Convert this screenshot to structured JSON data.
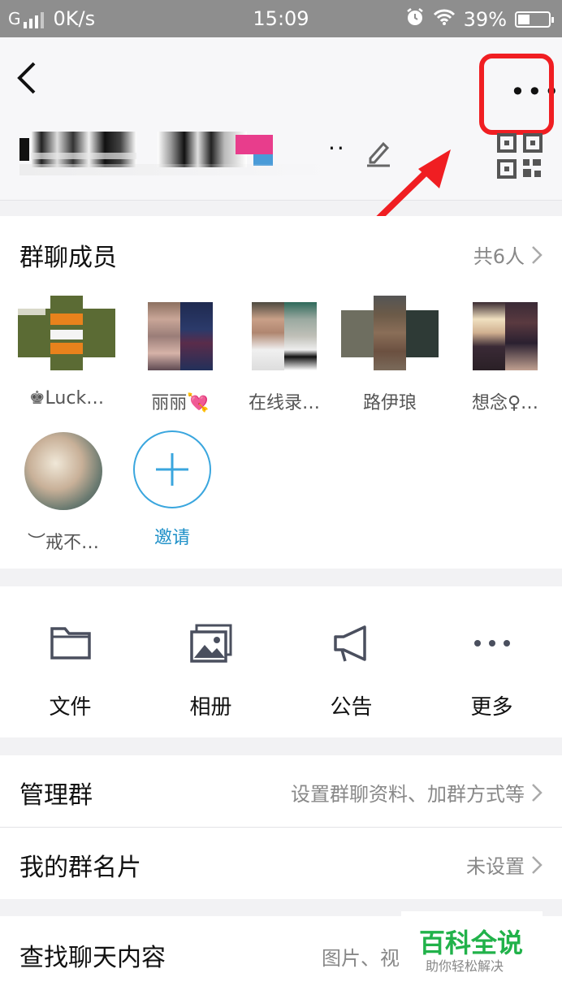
{
  "status_bar": {
    "signal": "G",
    "speed": "0K/s",
    "time": "15:09",
    "battery": "39%"
  },
  "group_title_ellipsis": "··",
  "members_section": {
    "title": "群聊成员",
    "count": "共6人",
    "members": [
      {
        "name": "♚Luck…"
      },
      {
        "name": "丽丽💘"
      },
      {
        "name": "在线录…"
      },
      {
        "name": "路伊琅"
      },
      {
        "name": "想念♀…"
      },
      {
        "name": "︶戒不…"
      }
    ],
    "invite_label": "邀请"
  },
  "tools": [
    {
      "label": "文件",
      "icon": "folder-icon"
    },
    {
      "label": "相册",
      "icon": "album-icon"
    },
    {
      "label": "公告",
      "icon": "megaphone-icon"
    },
    {
      "label": "更多",
      "icon": "more-icon"
    }
  ],
  "rows": {
    "manage": {
      "label": "管理群",
      "value": "设置群聊资料、加群方式等"
    },
    "card": {
      "label": "我的群名片",
      "value": "未设置"
    },
    "search": {
      "label": "查找聊天内容",
      "value": "图片、视"
    }
  },
  "watermark": {
    "title": "百科全说",
    "subtitle": "助你轻松解决"
  },
  "colors": {
    "accent": "#1e90c8",
    "highlight": "#f01e22",
    "watermark": "#21b24a"
  }
}
